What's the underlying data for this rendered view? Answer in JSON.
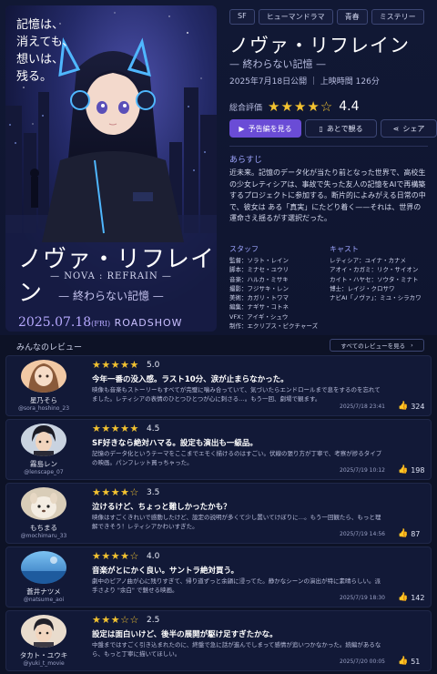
{
  "poster": {
    "tagline": [
      "記憶は、",
      "消えても、",
      "想いは、",
      "残る。"
    ],
    "title": "ノヴァ・リフレイン",
    "title_en": "— NOVA : REFRAIN —",
    "subtitle": "— 終わらない記憶 —",
    "date": "2025.07.18",
    "date_day": "(FRI)",
    "roadshow": "ROADSHOW"
  },
  "info": {
    "tags": [
      "SF",
      "ヒューマンドラマ",
      "青春",
      "ミステリー"
    ],
    "title": "ノヴァ・リフレイン",
    "subtitle": "— 終わらない記憶 —",
    "meta": "2025年7月18日公開 ｜ 上映時間 126分",
    "rating_label": "総合評価",
    "rating_stars": "★★★★☆",
    "rating_value": "4.4",
    "buttons": {
      "trailer": "予告編を見る",
      "later": "あとで観る",
      "share": "シェア"
    },
    "synopsis_heading": "あらすじ",
    "synopsis": "近未来。記憶のデータ化が当たり前となった世界で、高校生の少女レティシアは、事故で失った友人の記憶をAIで再構築するプロジェクトに参加する。断片的によみがえる日常の中で、彼女は ある「真実」にたどり着く——それは、世界の運命さえ揺るがす選択だった。",
    "staff_heading": "スタッフ",
    "staff": [
      "監督：ソラト・レイン",
      "脚本：ミナセ・ユウリ",
      "音楽：ハルカ・ミサキ",
      "撮影：フジサキ・レン",
      "美術：カガリ・トワマ",
      "編集：ナギサ・コトネ",
      "VFX：アイギ・シュウ",
      "制作：エクリプス・ピクチャーズ"
    ],
    "cast_heading": "キャスト",
    "cast": [
      "レティシア：ユイナ・カナメ",
      "アオイ・カガミ：リク・サイオン",
      "カイト・ハヤセ：ソウタ・ミナト",
      "博士：レイジ・クロサワ",
      "ナビAI「ノヴァ」：ミユ・シラカワ"
    ]
  },
  "reviews": {
    "heading": "みんなのレビュー",
    "see_all": "すべてのレビューを見る",
    "items": [
      {
        "name": "星乃そら",
        "handle": "@sora_hoshino_23",
        "stars": "★★★★★",
        "score": "5.0",
        "title": "今年一番の没入感。ラスト10分、涙が止まらなかった。",
        "body": "映像も音楽もストーリーもすべてが完璧に噛み合っていて、気づいたらエンドロールまで息をするのを忘れてました。レティシアの表情のひとつひとつが心に刺さる…。もう一回、劇場で観ます。",
        "date": "2025/7/18 23:41",
        "likes": "324"
      },
      {
        "name": "霧島レン",
        "handle": "@lenscape_07",
        "stars": "★★★★★",
        "score": "4.5",
        "title": "SF好きなら絶対ハマる。設定も演出も一級品。",
        "body": "記憶のデータ化というテーマをここまでエモく描けるのはすごい。伏線の張り方が丁寧で、考察が捗るタイプの映画。パンフレット買っちゃった。",
        "date": "2025/7/19 10:12",
        "likes": "198"
      },
      {
        "name": "もちまる",
        "handle": "@mochimaru_33",
        "stars": "★★★★☆",
        "score": "3.5",
        "title": "泣けるけど、ちょっと難しかったかも？",
        "body": "映像はすごくきれいで感動したけど、設定の説明が多くて少し置いてけぼりに…。もう一回観たら、もっと理解できそう！レティシアかわいすぎた。",
        "date": "2025/7/19 14:56",
        "likes": "87"
      },
      {
        "name": "蒼井ナツメ",
        "handle": "@natsume_aoi",
        "stars": "★★★★☆",
        "score": "4.0",
        "title": "音楽がとにかく良い。サントラ絶対買う。",
        "body": "劇中のピアノ曲が心に残りすぎて、帰り道ずっと余韻に浸ってた。静かなシーンの演出が特に素晴らしい。派手さより \"余白\" で魅せる映画。",
        "date": "2025/7/19 18:30",
        "likes": "142"
      },
      {
        "name": "タカト・ユウキ",
        "handle": "@yuki_t_movie",
        "stars": "★★★☆☆",
        "score": "2.5",
        "title": "設定は面白いけど、後半の展開が駆け足すぎたかな。",
        "body": "中盤まではすごく引き込まれたのに、終盤で急に話が進んでしまって感情が追いつかなかった。続編があるなら、もっと丁寧に描いてほしい。",
        "date": "2025/7/20 00:05",
        "likes": "51"
      }
    ]
  },
  "colors": {
    "accent": "#6a4cd6",
    "star": "#f2c230",
    "background": "#0d1226"
  }
}
